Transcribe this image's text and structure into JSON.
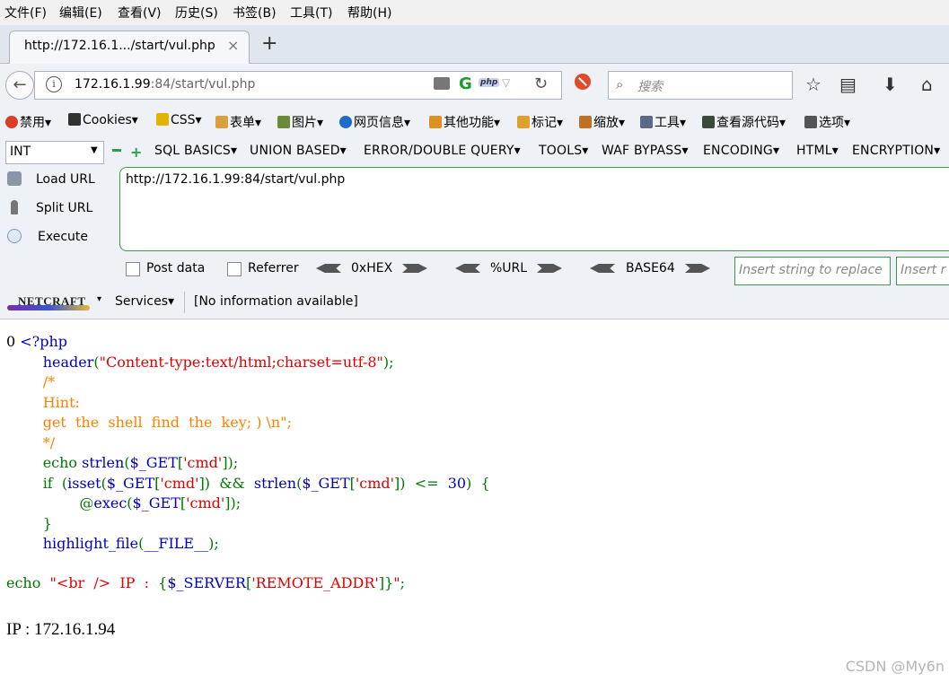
{
  "menu": [
    "文件(F)",
    "编辑(E)",
    "查看(V)",
    "历史(S)",
    "书签(B)",
    "工具(T)",
    "帮助(H)"
  ],
  "tab": {
    "title": "http://172.16.1.../start/vul.php",
    "close": "×",
    "new": "+"
  },
  "nav": {
    "url_host": "172.16.1.99",
    "url_rest": ":84/start/vul.php",
    "g_label": "G",
    "php_badge": "php",
    "search_placeholder": "搜索"
  },
  "bookmarks": [
    {
      "label": "禁用▾",
      "color": "#d9402a"
    },
    {
      "label": "Cookies▾",
      "color": "#333333"
    },
    {
      "label": "CSS▾",
      "color": "#e2b400"
    },
    {
      "label": "表单▾",
      "color": "#d9a040"
    },
    {
      "label": "图片▾",
      "color": "#6a8a3a"
    },
    {
      "label": "网页信息▾",
      "color": "#1a6cc8"
    },
    {
      "label": "其他功能▾",
      "color": "#e09020"
    },
    {
      "label": "标记▾",
      "color": "#e0a030"
    },
    {
      "label": "缩放▾",
      "color": "#c07020"
    },
    {
      "label": "工具▾",
      "color": "#5a6a8a"
    },
    {
      "label": "查看源代码▾",
      "color": "#3a4a3a"
    },
    {
      "label": "选项▾",
      "color": "#555555"
    }
  ],
  "hackbar": {
    "type_value": "INT",
    "menus": [
      "SQL BASICS▾",
      "UNION BASED▾",
      "ERROR/DOUBLE QUERY▾",
      "TOOLS▾",
      "WAF BYPASS▾",
      "ENCODING▾",
      "HTML▾",
      "ENCRYPTION▾"
    ],
    "load_url": "Load URL",
    "split_url": "Split URL",
    "execute": "Execute",
    "url_value": "http://172.16.1.99:84/start/vul.php",
    "post_data": "Post data",
    "referrer": "Referrer",
    "enc1": "0xHEX",
    "enc2": "%URL",
    "enc3": "BASE64",
    "insert1_placeholder": "Insert string to replace",
    "insert2_placeholder": "Insert r"
  },
  "netcraft": {
    "logo": "NETCRAFT",
    "services": "Services▾",
    "info": "[No information available]"
  },
  "code": {
    "prefix": "0 ",
    "open_tag": "<?php",
    "l2_fn": "header",
    "l2_open": "(",
    "l2_str": "\"Content-type:text/html;charset=utf-8\"",
    "l2_close": ");",
    "l3": "/*",
    "l4": "Hint:",
    "l5": "get  the  shell  find  the  key; ) \\n\";",
    "l6": "*/",
    "l7_echo": "echo ",
    "l7_fn": "strlen",
    "l7_a": "(",
    "l7_var": "$_GET",
    "l7_b": "[",
    "l7_key": "'cmd'",
    "l7_c": "]);",
    "l8_if": "if  (",
    "l8_isset": "isset",
    "l8_a": "(",
    "l8_var": "$_GET",
    "l8_b": "[",
    "l8_key": "'cmd'",
    "l8_c": "])  &&  ",
    "l8_fn": "strlen",
    "l8_d": "(",
    "l8_var2": "$_GET",
    "l8_e": "[",
    "l8_key2": "'cmd'",
    "l8_f": "])  <=  ",
    "l8_num": "30",
    "l8_g": ")  {",
    "l9_at": "@",
    "l9_fn": "exec",
    "l9_a": "(",
    "l9_var": "$_GET",
    "l9_b": "[",
    "l9_key": "'cmd'",
    "l9_c": "]);",
    "l10": "}",
    "l11_fn": "highlight_file",
    "l11_a": "(",
    "l11_const": "__FILE__",
    "l11_b": ");",
    "echo_kw": "echo  ",
    "echo_str1": "\"<br  />  IP  :  ",
    "echo_brace1": "{",
    "echo_var": "$_SERVER",
    "echo_b1": "[",
    "echo_key": "'REMOTE_ADDR'",
    "echo_b2": "]}",
    "echo_str2": "\"",
    "echo_end": ";"
  },
  "output": {
    "ip_line": "IP : 172.16.1.94"
  },
  "watermark": "CSDN @My6n"
}
